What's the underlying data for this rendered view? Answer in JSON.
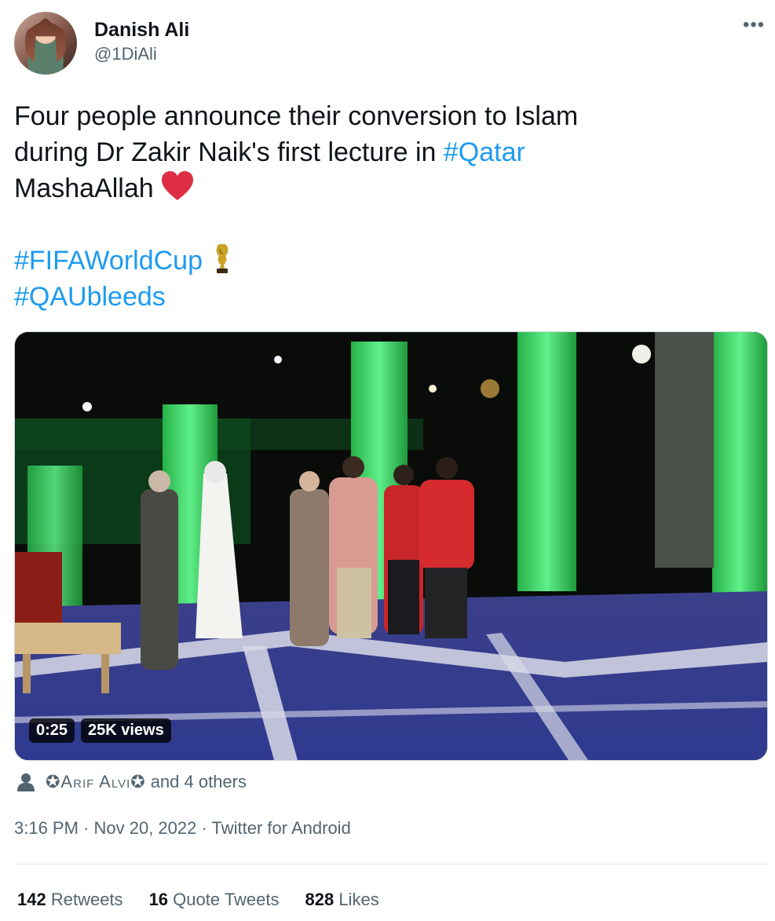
{
  "author": {
    "name": "Danish Ali",
    "handle": "@1DiAli"
  },
  "more_icon": "more-dots-icon",
  "tweet": {
    "line1": "Four people announce their conversion to Islam",
    "line2_prefix": "during Dr Zakir Naik's first lecture in ",
    "line2_hashtag": "#Qatar",
    "line3": "MashaAllah",
    "heart_emoji": "red-heart-icon",
    "hashtag_fifa": "#FIFAWorldCup",
    "trophy_emoji": "trophy-icon",
    "hashtag_qau": "#QAUbleeds"
  },
  "video": {
    "duration": "0:25",
    "views": "25K views"
  },
  "tagged": {
    "icon": "person-icon",
    "user": "✪Arif Alvi✪",
    "rest": "and 4 others"
  },
  "meta": "3:16 PM · Nov 20, 2022 · Twitter for Android",
  "stats": {
    "retweets_count": "142",
    "retweets_label": "Retweets",
    "quotes_count": "16",
    "quotes_label": "Quote Tweets",
    "likes_count": "828",
    "likes_label": "Likes"
  },
  "colors": {
    "link": "#1d9bf0",
    "secondary": "#536471",
    "heart": "#e0245e"
  }
}
